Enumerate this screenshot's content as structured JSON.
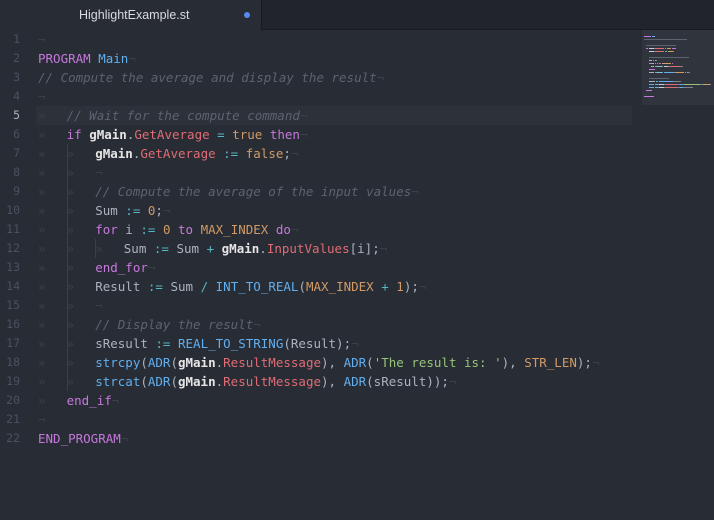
{
  "tab": {
    "title": "HighlightExample.st",
    "modified": true
  },
  "editor": {
    "active_line": 5,
    "line_numbers": [
      "1",
      "2",
      "3",
      "4",
      "5",
      "6",
      "7",
      "8",
      "9",
      "10",
      "11",
      "12",
      "13",
      "14",
      "15",
      "16",
      "17",
      "18",
      "19",
      "20",
      "21",
      "22"
    ],
    "invisible_eol": "¬",
    "invisible_tab": "»",
    "lines": [
      {
        "indent": 0,
        "tokens": []
      },
      {
        "indent": 0,
        "tokens": [
          {
            "t": "PROGRAM",
            "c": "kw"
          },
          {
            "t": " ",
            "c": "punc"
          },
          {
            "t": "Main",
            "c": "fn"
          }
        ]
      },
      {
        "indent": 0,
        "tokens": [
          {
            "t": "// Compute the average and display the result",
            "c": "cmt"
          }
        ]
      },
      {
        "indent": 0,
        "tokens": []
      },
      {
        "indent": 1,
        "tokens": [
          {
            "t": "// Wait for the compute command",
            "c": "cmt"
          }
        ]
      },
      {
        "indent": 1,
        "tokens": [
          {
            "t": "if",
            "c": "kw"
          },
          {
            "t": " ",
            "c": "punc"
          },
          {
            "t": "gMain",
            "c": "obj"
          },
          {
            "t": ".",
            "c": "punc"
          },
          {
            "t": "GetAverage",
            "c": "prop"
          },
          {
            "t": " ",
            "c": "punc"
          },
          {
            "t": "=",
            "c": "op"
          },
          {
            "t": " ",
            "c": "punc"
          },
          {
            "t": "true",
            "c": "bool"
          },
          {
            "t": " ",
            "c": "punc"
          },
          {
            "t": "then",
            "c": "kw"
          }
        ]
      },
      {
        "indent": 2,
        "tokens": [
          {
            "t": "gMain",
            "c": "obj"
          },
          {
            "t": ".",
            "c": "punc"
          },
          {
            "t": "GetAverage",
            "c": "prop"
          },
          {
            "t": " ",
            "c": "punc"
          },
          {
            "t": ":=",
            "c": "op"
          },
          {
            "t": " ",
            "c": "punc"
          },
          {
            "t": "false",
            "c": "bool"
          },
          {
            "t": ";",
            "c": "punc"
          }
        ]
      },
      {
        "indent": 2,
        "tokens": []
      },
      {
        "indent": 2,
        "tokens": [
          {
            "t": "// Compute the average of the input values",
            "c": "cmt"
          }
        ]
      },
      {
        "indent": 2,
        "tokens": [
          {
            "t": "Sum",
            "c": "id"
          },
          {
            "t": " ",
            "c": "punc"
          },
          {
            "t": ":=",
            "c": "op"
          },
          {
            "t": " ",
            "c": "punc"
          },
          {
            "t": "0",
            "c": "num"
          },
          {
            "t": ";",
            "c": "punc"
          }
        ]
      },
      {
        "indent": 2,
        "tokens": [
          {
            "t": "for",
            "c": "kw"
          },
          {
            "t": " i ",
            "c": "id"
          },
          {
            "t": ":=",
            "c": "op"
          },
          {
            "t": " ",
            "c": "punc"
          },
          {
            "t": "0",
            "c": "num"
          },
          {
            "t": " ",
            "c": "punc"
          },
          {
            "t": "to",
            "c": "kw"
          },
          {
            "t": " ",
            "c": "punc"
          },
          {
            "t": "MAX_INDEX",
            "c": "const"
          },
          {
            "t": " ",
            "c": "punc"
          },
          {
            "t": "do",
            "c": "kw"
          }
        ]
      },
      {
        "indent": 3,
        "tokens": [
          {
            "t": "Sum",
            "c": "id"
          },
          {
            "t": " ",
            "c": "punc"
          },
          {
            "t": ":=",
            "c": "op"
          },
          {
            "t": " Sum ",
            "c": "id"
          },
          {
            "t": "+",
            "c": "op"
          },
          {
            "t": " ",
            "c": "punc"
          },
          {
            "t": "gMain",
            "c": "obj"
          },
          {
            "t": ".",
            "c": "punc"
          },
          {
            "t": "InputValues",
            "c": "prop"
          },
          {
            "t": "[i];",
            "c": "punc"
          }
        ]
      },
      {
        "indent": 2,
        "tokens": [
          {
            "t": "end_for",
            "c": "kw"
          }
        ]
      },
      {
        "indent": 2,
        "tokens": [
          {
            "t": "Result",
            "c": "id"
          },
          {
            "t": " ",
            "c": "punc"
          },
          {
            "t": ":=",
            "c": "op"
          },
          {
            "t": " Sum ",
            "c": "id"
          },
          {
            "t": "/",
            "c": "op"
          },
          {
            "t": " ",
            "c": "punc"
          },
          {
            "t": "INT_TO_REAL",
            "c": "fn"
          },
          {
            "t": "(",
            "c": "punc"
          },
          {
            "t": "MAX_INDEX",
            "c": "const"
          },
          {
            "t": " ",
            "c": "punc"
          },
          {
            "t": "+",
            "c": "op"
          },
          {
            "t": " ",
            "c": "punc"
          },
          {
            "t": "1",
            "c": "num"
          },
          {
            "t": ");",
            "c": "punc"
          }
        ]
      },
      {
        "indent": 2,
        "tokens": []
      },
      {
        "indent": 2,
        "tokens": [
          {
            "t": "// Display the result",
            "c": "cmt"
          }
        ]
      },
      {
        "indent": 2,
        "tokens": [
          {
            "t": "sResult",
            "c": "id"
          },
          {
            "t": " ",
            "c": "punc"
          },
          {
            "t": ":=",
            "c": "op"
          },
          {
            "t": " ",
            "c": "punc"
          },
          {
            "t": "REAL_TO_STRING",
            "c": "fn"
          },
          {
            "t": "(Result);",
            "c": "punc"
          }
        ]
      },
      {
        "indent": 2,
        "tokens": [
          {
            "t": "strcpy",
            "c": "fn"
          },
          {
            "t": "(",
            "c": "punc"
          },
          {
            "t": "ADR",
            "c": "fn"
          },
          {
            "t": "(",
            "c": "punc"
          },
          {
            "t": "gMain",
            "c": "obj"
          },
          {
            "t": ".",
            "c": "punc"
          },
          {
            "t": "ResultMessage",
            "c": "prop"
          },
          {
            "t": "), ",
            "c": "punc"
          },
          {
            "t": "ADR",
            "c": "fn"
          },
          {
            "t": "(",
            "c": "punc"
          },
          {
            "t": "'The result is: '",
            "c": "str"
          },
          {
            "t": "), ",
            "c": "punc"
          },
          {
            "t": "STR_LEN",
            "c": "const"
          },
          {
            "t": ");",
            "c": "punc"
          }
        ]
      },
      {
        "indent": 2,
        "tokens": [
          {
            "t": "strcat",
            "c": "fn"
          },
          {
            "t": "(",
            "c": "punc"
          },
          {
            "t": "ADR",
            "c": "fn"
          },
          {
            "t": "(",
            "c": "punc"
          },
          {
            "t": "gMain",
            "c": "obj"
          },
          {
            "t": ".",
            "c": "punc"
          },
          {
            "t": "ResultMessage",
            "c": "prop"
          },
          {
            "t": "), ",
            "c": "punc"
          },
          {
            "t": "ADR",
            "c": "fn"
          },
          {
            "t": "(sResult));",
            "c": "punc"
          }
        ]
      },
      {
        "indent": 1,
        "tokens": [
          {
            "t": "end_if",
            "c": "kw"
          }
        ]
      },
      {
        "indent": 0,
        "tokens": []
      },
      {
        "indent": 0,
        "tokens": [
          {
            "t": "END_PROGRAM",
            "c": "kw"
          }
        ]
      }
    ]
  },
  "colors": {
    "background": "#282c34",
    "tabbar": "#21252b",
    "keyword": "#c678dd",
    "function": "#61afef",
    "property": "#e06c75",
    "constant": "#d19a66",
    "string": "#98c379",
    "comment": "#5c6370",
    "accent": "#568af2"
  }
}
